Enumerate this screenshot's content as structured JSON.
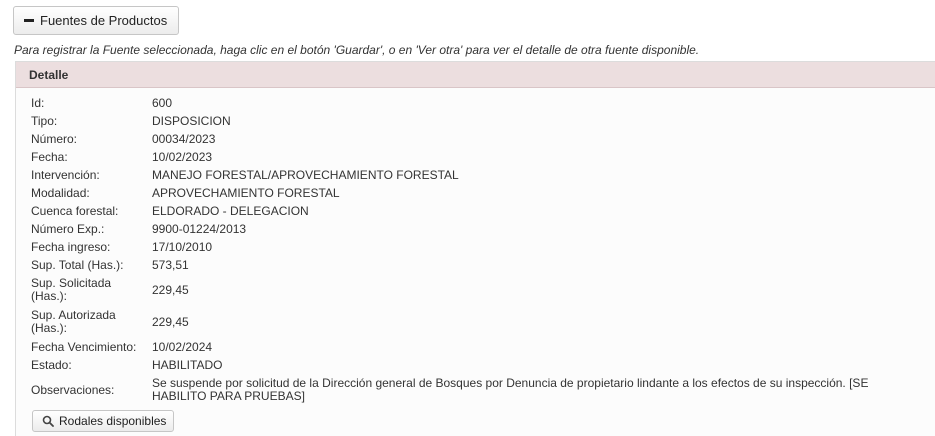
{
  "header": {
    "toggle_label": "Fuentes de Productos"
  },
  "instructions": "Para registrar la Fuente seleccionada, haga clic en el botón 'Guardar', o en 'Ver otra' para ver el detalle de otra fuente disponible.",
  "detail": {
    "title": "Detalle",
    "fields": [
      {
        "label": "Id:",
        "value": "600"
      },
      {
        "label": "Tipo:",
        "value": "DISPOSICION"
      },
      {
        "label": "Número:",
        "value": "00034/2023"
      },
      {
        "label": "Fecha:",
        "value": "10/02/2023"
      },
      {
        "label": "Intervención:",
        "value": "MANEJO FORESTAL/APROVECHAMIENTO FORESTAL"
      },
      {
        "label": "Modalidad:",
        "value": "APROVECHAMIENTO FORESTAL"
      },
      {
        "label": "Cuenca forestal:",
        "value": "ELDORADO - DELEGACION"
      },
      {
        "label": "Número Exp.:",
        "value": "9900-01224/2013"
      },
      {
        "label": "Fecha ingreso:",
        "value": "17/10/2010"
      },
      {
        "label": "Sup. Total (Has.):",
        "value": "573,51"
      },
      {
        "label": "Sup. Solicitada (Has.):",
        "value": "229,45"
      },
      {
        "label": "Sup. Autorizada (Has.):",
        "value": "229,45"
      },
      {
        "label": "Fecha Vencimiento:",
        "value": "10/02/2024"
      },
      {
        "label": "Estado:",
        "value": "HABILITADO"
      },
      {
        "label": "Observaciones:",
        "value": "Se suspende por solicitud de la Dirección general de Bosques por Denuncia de propietario lindante a los efectos de su inspección. [SE HABILITO PARA PRUEBAS]"
      }
    ],
    "rodales_button_label": "Rodales disponibles"
  },
  "icons": {
    "toggle": "minus-icon",
    "rodales": "search-icon"
  }
}
